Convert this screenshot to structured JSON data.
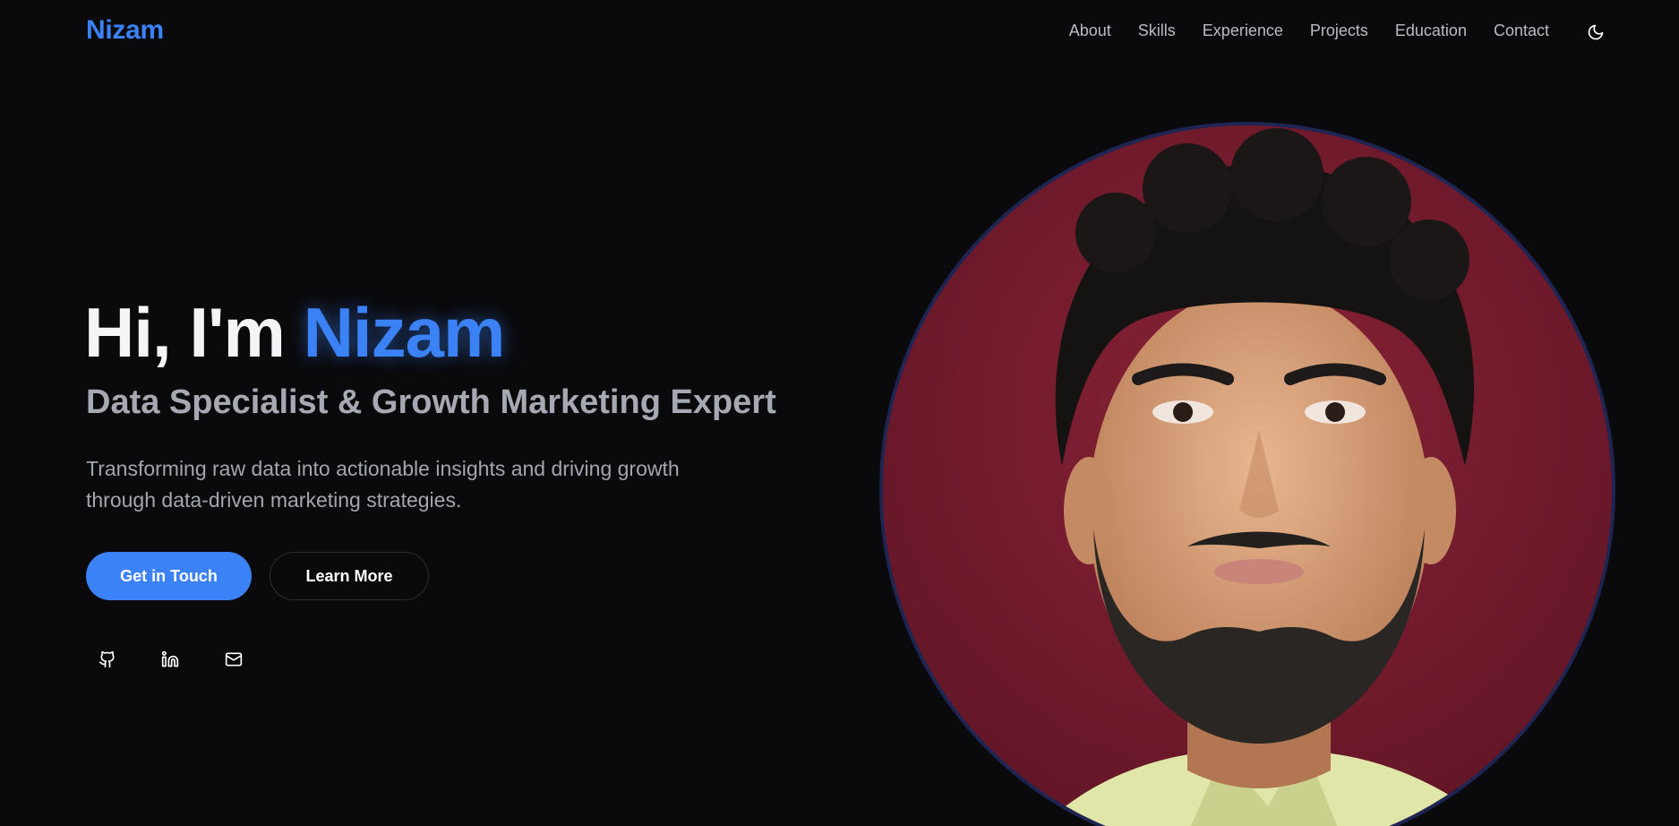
{
  "header": {
    "logo": "Nizam",
    "nav": {
      "about": "About",
      "skills": "Skills",
      "experience": "Experience",
      "projects": "Projects",
      "education": "Education",
      "contact": "Contact"
    },
    "theme_toggle_icon": "moon-icon"
  },
  "hero": {
    "greeting": "Hi, I'm ",
    "name": "Nizam",
    "subtitle": "Data Specialist & Growth Marketing Expert",
    "description": "Transforming raw data into actionable insights and driving growth through data-driven marketing strategies.",
    "primary_button": "Get in Touch",
    "secondary_button": "Learn More",
    "social_icons": [
      "github-icon",
      "linkedin-icon",
      "mail-icon"
    ]
  },
  "colors": {
    "background": "#0a0a0d",
    "accent": "#3b82f6",
    "muted_text": "#a6a9b2",
    "portrait_backdrop": "#6e1a2c"
  }
}
